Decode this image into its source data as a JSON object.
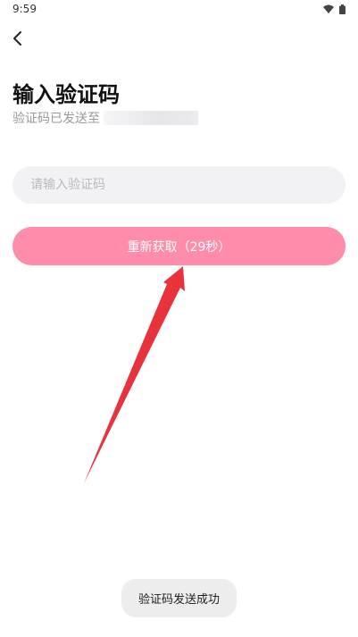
{
  "status_bar": {
    "time": "9:59"
  },
  "header": {
    "title": "输入验证码",
    "subtitle_prefix": "验证码已发送至"
  },
  "form": {
    "code_placeholder": "请输入验证码",
    "code_value": ""
  },
  "resend_button": {
    "label": "重新获取（29秒）"
  },
  "toast": {
    "message": "验证码发送成功"
  },
  "colors": {
    "accent": "#ff8cab",
    "input_bg": "#f2f2f4",
    "annotation_arrow": "#e8323c"
  },
  "icons": [
    "wifi-icon",
    "battery-icon",
    "back-arrow-icon"
  ]
}
